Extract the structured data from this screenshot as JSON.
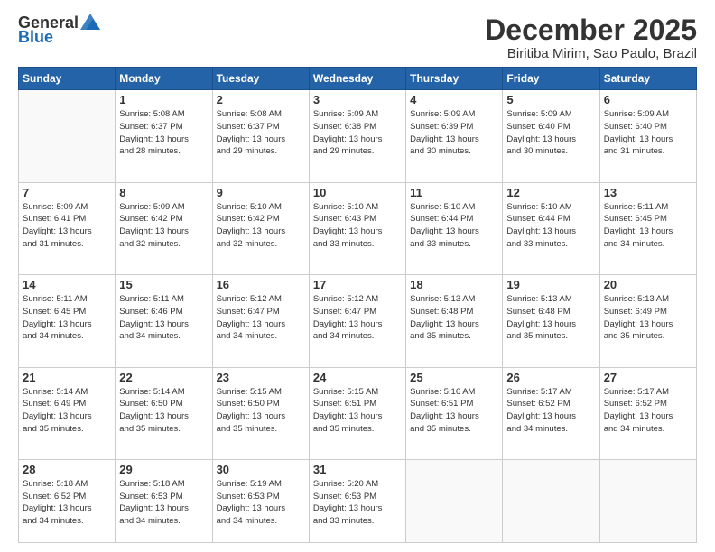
{
  "logo": {
    "general": "General",
    "blue": "Blue"
  },
  "header": {
    "title": "December 2025",
    "subtitle": "Biritiba Mirim, Sao Paulo, Brazil"
  },
  "days_of_week": [
    "Sunday",
    "Monday",
    "Tuesday",
    "Wednesday",
    "Thursday",
    "Friday",
    "Saturday"
  ],
  "weeks": [
    [
      {
        "day": "",
        "info": ""
      },
      {
        "day": "1",
        "info": "Sunrise: 5:08 AM\nSunset: 6:37 PM\nDaylight: 13 hours\nand 28 minutes."
      },
      {
        "day": "2",
        "info": "Sunrise: 5:08 AM\nSunset: 6:37 PM\nDaylight: 13 hours\nand 29 minutes."
      },
      {
        "day": "3",
        "info": "Sunrise: 5:09 AM\nSunset: 6:38 PM\nDaylight: 13 hours\nand 29 minutes."
      },
      {
        "day": "4",
        "info": "Sunrise: 5:09 AM\nSunset: 6:39 PM\nDaylight: 13 hours\nand 30 minutes."
      },
      {
        "day": "5",
        "info": "Sunrise: 5:09 AM\nSunset: 6:40 PM\nDaylight: 13 hours\nand 30 minutes."
      },
      {
        "day": "6",
        "info": "Sunrise: 5:09 AM\nSunset: 6:40 PM\nDaylight: 13 hours\nand 31 minutes."
      }
    ],
    [
      {
        "day": "7",
        "info": "Sunrise: 5:09 AM\nSunset: 6:41 PM\nDaylight: 13 hours\nand 31 minutes."
      },
      {
        "day": "8",
        "info": "Sunrise: 5:09 AM\nSunset: 6:42 PM\nDaylight: 13 hours\nand 32 minutes."
      },
      {
        "day": "9",
        "info": "Sunrise: 5:10 AM\nSunset: 6:42 PM\nDaylight: 13 hours\nand 32 minutes."
      },
      {
        "day": "10",
        "info": "Sunrise: 5:10 AM\nSunset: 6:43 PM\nDaylight: 13 hours\nand 33 minutes."
      },
      {
        "day": "11",
        "info": "Sunrise: 5:10 AM\nSunset: 6:44 PM\nDaylight: 13 hours\nand 33 minutes."
      },
      {
        "day": "12",
        "info": "Sunrise: 5:10 AM\nSunset: 6:44 PM\nDaylight: 13 hours\nand 33 minutes."
      },
      {
        "day": "13",
        "info": "Sunrise: 5:11 AM\nSunset: 6:45 PM\nDaylight: 13 hours\nand 34 minutes."
      }
    ],
    [
      {
        "day": "14",
        "info": "Sunrise: 5:11 AM\nSunset: 6:45 PM\nDaylight: 13 hours\nand 34 minutes."
      },
      {
        "day": "15",
        "info": "Sunrise: 5:11 AM\nSunset: 6:46 PM\nDaylight: 13 hours\nand 34 minutes."
      },
      {
        "day": "16",
        "info": "Sunrise: 5:12 AM\nSunset: 6:47 PM\nDaylight: 13 hours\nand 34 minutes."
      },
      {
        "day": "17",
        "info": "Sunrise: 5:12 AM\nSunset: 6:47 PM\nDaylight: 13 hours\nand 34 minutes."
      },
      {
        "day": "18",
        "info": "Sunrise: 5:13 AM\nSunset: 6:48 PM\nDaylight: 13 hours\nand 35 minutes."
      },
      {
        "day": "19",
        "info": "Sunrise: 5:13 AM\nSunset: 6:48 PM\nDaylight: 13 hours\nand 35 minutes."
      },
      {
        "day": "20",
        "info": "Sunrise: 5:13 AM\nSunset: 6:49 PM\nDaylight: 13 hours\nand 35 minutes."
      }
    ],
    [
      {
        "day": "21",
        "info": "Sunrise: 5:14 AM\nSunset: 6:49 PM\nDaylight: 13 hours\nand 35 minutes."
      },
      {
        "day": "22",
        "info": "Sunrise: 5:14 AM\nSunset: 6:50 PM\nDaylight: 13 hours\nand 35 minutes."
      },
      {
        "day": "23",
        "info": "Sunrise: 5:15 AM\nSunset: 6:50 PM\nDaylight: 13 hours\nand 35 minutes."
      },
      {
        "day": "24",
        "info": "Sunrise: 5:15 AM\nSunset: 6:51 PM\nDaylight: 13 hours\nand 35 minutes."
      },
      {
        "day": "25",
        "info": "Sunrise: 5:16 AM\nSunset: 6:51 PM\nDaylight: 13 hours\nand 35 minutes."
      },
      {
        "day": "26",
        "info": "Sunrise: 5:17 AM\nSunset: 6:52 PM\nDaylight: 13 hours\nand 34 minutes."
      },
      {
        "day": "27",
        "info": "Sunrise: 5:17 AM\nSunset: 6:52 PM\nDaylight: 13 hours\nand 34 minutes."
      }
    ],
    [
      {
        "day": "28",
        "info": "Sunrise: 5:18 AM\nSunset: 6:52 PM\nDaylight: 13 hours\nand 34 minutes."
      },
      {
        "day": "29",
        "info": "Sunrise: 5:18 AM\nSunset: 6:53 PM\nDaylight: 13 hours\nand 34 minutes."
      },
      {
        "day": "30",
        "info": "Sunrise: 5:19 AM\nSunset: 6:53 PM\nDaylight: 13 hours\nand 34 minutes."
      },
      {
        "day": "31",
        "info": "Sunrise: 5:20 AM\nSunset: 6:53 PM\nDaylight: 13 hours\nand 33 minutes."
      },
      {
        "day": "",
        "info": ""
      },
      {
        "day": "",
        "info": ""
      },
      {
        "day": "",
        "info": ""
      }
    ]
  ]
}
